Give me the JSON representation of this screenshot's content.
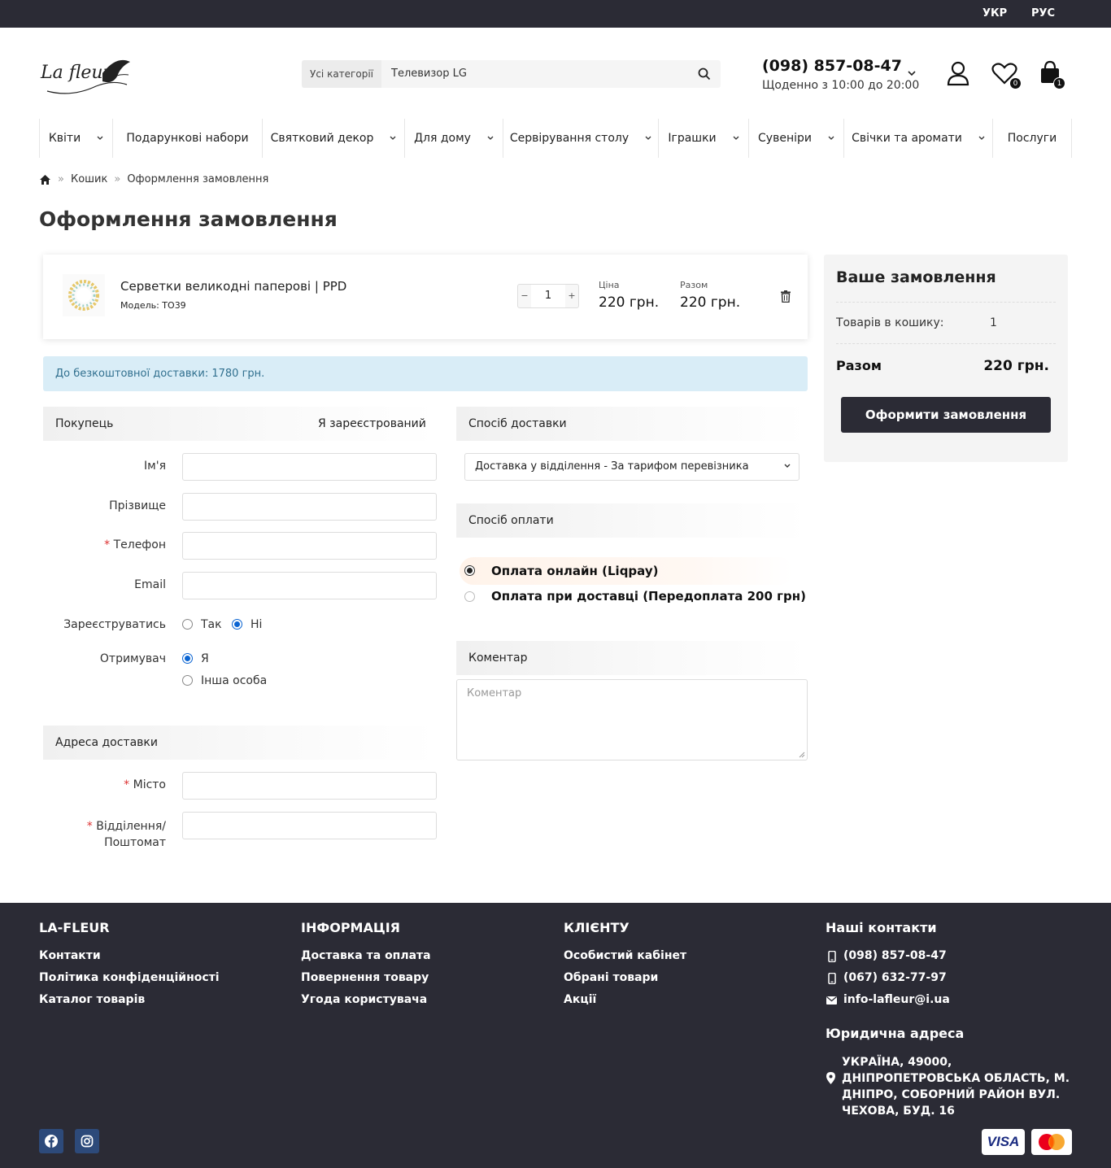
{
  "topbar": {
    "lang_uk": "УКР",
    "lang_ru": "РУС"
  },
  "header": {
    "search_category": "Усі категорії",
    "search_value": "Телевизор LG",
    "phone": "(098) 857-08-47",
    "hours": "Щоденно з 10:00 до 20:00",
    "wishlist_count": "0",
    "cart_count": "1"
  },
  "nav": [
    "Квіти",
    "Подарункові набори",
    "Святковий декор",
    "Для дому",
    "Сервірування столу",
    "Іграшки",
    "Сувеніри",
    "Свічки та аромати",
    "Послуги"
  ],
  "breadcrumb": {
    "cart": "Кошик",
    "current": "Оформлення замовлення"
  },
  "page_title": "Оформлення замовлення",
  "cart_item": {
    "name": "Серветки великодні паперові | PPD",
    "model": "Модель: TO39",
    "qty": "1",
    "minus": "−",
    "plus": "+",
    "price_label": "Ціна",
    "price": "220 грн.",
    "total_label": "Разом",
    "total": "220 грн."
  },
  "notice": "До безкоштовної доставки: 1780 грн.",
  "buyer": {
    "heading": "Покупець",
    "registered_link": "Я зареєстрований",
    "first_name_label": "Ім'я",
    "last_name_label": "Прізвище",
    "phone_label": "Телефон",
    "email_label": "Email",
    "register_label": "Зареєструватись",
    "register_yes": "Так",
    "register_no": "Ні",
    "recipient_label": "Отримувач",
    "recipient_me": "Я",
    "recipient_other": "Інша особа"
  },
  "address": {
    "heading": "Адреса доставки",
    "city_label": "Місто",
    "branch_label_1": "Відділення/",
    "branch_label_2": "Поштомат"
  },
  "shipping": {
    "heading": "Спосіб доставки",
    "selected": "Доставка у відділення - За тарифом перевізника"
  },
  "payment": {
    "heading": "Спосіб оплати",
    "option1": "Оплата онлайн (Liqpay)",
    "option2": "Оплата при доставці (Передоплата 200 грн)"
  },
  "comment": {
    "heading": "Коментар",
    "placeholder": "Коментар"
  },
  "summary": {
    "title": "Ваше замовлення",
    "items_label": "Товарів в кошику:",
    "items_count": "1",
    "total_label": "Разом",
    "total_value": "220 грн.",
    "checkout_button": "Оформити замовлення"
  },
  "footer": {
    "col1_title": "LA-FLEUR",
    "col1_links": [
      "Контакти",
      "Політика конфіденційності",
      "Каталог товарів"
    ],
    "col2_title": "ІНФОРМАЦІЯ",
    "col2_links": [
      "Доставка та оплата",
      "Повернення товару",
      "Угода користувача"
    ],
    "col3_title": "КЛІЄНТУ",
    "col3_links": [
      "Особистий кабінет",
      "Обрані товари",
      "Акції"
    ],
    "contacts_title": "Наші контакти",
    "phone1": "(098) 857-08-47",
    "phone2": "(067) 632-77-97",
    "email": "info-lafleur@i.ua",
    "legal_title": "Юридична адреса",
    "address": "УКРАЇНА, 49000, ДНІПРОПЕТРОВСЬКА ОБЛАСТЬ, М. ДНІПРО, СОБОРНИЙ РАЙОН ВУЛ. ЧЕХОВА, БУД. 16",
    "visa": "VISA"
  },
  "colors": {
    "dark": "#2b2b35",
    "notice_bg": "#d9edf7",
    "notice_text": "#31708f",
    "required": "#d33333",
    "radio_blue": "#0a64d2"
  }
}
